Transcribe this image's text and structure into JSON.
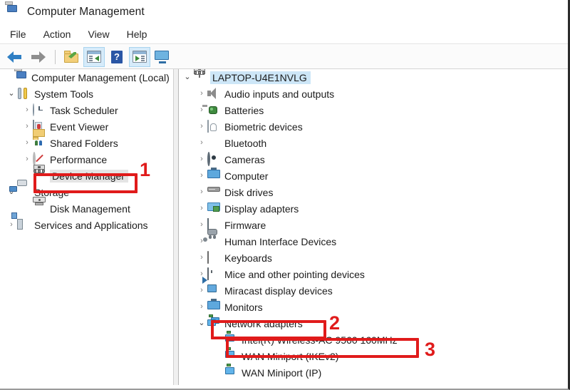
{
  "window": {
    "title": "Computer Management",
    "title_icon": "computer-management-icon"
  },
  "menu": {
    "items": [
      "File",
      "Action",
      "View",
      "Help"
    ]
  },
  "toolbar": {
    "buttons": [
      {
        "name": "back-button",
        "icon": "back-arrow-icon",
        "selected": false
      },
      {
        "name": "forward-button",
        "icon": "forward-arrow-icon",
        "selected": false
      },
      {
        "name": "up-one-level-button",
        "icon": "folder-up-icon",
        "selected": false
      },
      {
        "name": "show-hide-console-tree-button",
        "icon": "console-tree-icon",
        "selected": true
      },
      {
        "name": "help-button",
        "icon": "help-question-icon",
        "selected": false
      },
      {
        "name": "show-hide-action-pane-button",
        "icon": "action-pane-icon",
        "selected": true
      },
      {
        "name": "remote-connection-button",
        "icon": "monitor-icon",
        "selected": false
      }
    ]
  },
  "console_tree": {
    "root": {
      "label": "Computer Management (Local)",
      "icon": "computer-management-icon",
      "indent": 0,
      "chevron": "none"
    },
    "items": [
      {
        "label": "System Tools",
        "icon": "system-tools-icon",
        "indent": 1,
        "chevron": "open",
        "selected": false
      },
      {
        "label": "Task Scheduler",
        "icon": "clock-icon",
        "indent": 2,
        "chevron": "closed",
        "selected": false
      },
      {
        "label": "Event Viewer",
        "icon": "event-viewer-icon",
        "indent": 2,
        "chevron": "closed",
        "selected": false
      },
      {
        "label": "Shared Folders",
        "icon": "shared-folders-icon",
        "indent": 2,
        "chevron": "closed",
        "selected": false
      },
      {
        "label": "Performance",
        "icon": "performance-icon",
        "indent": 2,
        "chevron": "closed",
        "selected": false
      },
      {
        "label": "Device Manager",
        "icon": "device-manager-icon",
        "indent": 2,
        "chevron": "none",
        "selected": true
      },
      {
        "label": "Storage",
        "icon": "storage-icon",
        "indent": 1,
        "chevron": "open",
        "selected": false
      },
      {
        "label": "Disk Management",
        "icon": "disk-management-icon",
        "indent": 2,
        "chevron": "none",
        "selected": false
      },
      {
        "label": "Services and Applications",
        "icon": "services-icon",
        "indent": 1,
        "chevron": "closed",
        "selected": false
      }
    ]
  },
  "device_tree": {
    "root": {
      "label": "LAPTOP-U4E1NVLG",
      "icon": "device-manager-icon",
      "chevron": "open",
      "selected": true
    },
    "items": [
      {
        "label": "Audio inputs and outputs",
        "icon": "speaker-icon",
        "chevron": "closed",
        "indent": 1
      },
      {
        "label": "Batteries",
        "icon": "battery-icon",
        "chevron": "closed",
        "indent": 1
      },
      {
        "label": "Biometric devices",
        "icon": "fingerprint-icon",
        "chevron": "closed",
        "indent": 1
      },
      {
        "label": "Bluetooth",
        "icon": "bluetooth-icon",
        "chevron": "closed",
        "indent": 1
      },
      {
        "label": "Cameras",
        "icon": "camera-icon",
        "chevron": "closed",
        "indent": 1
      },
      {
        "label": "Computer",
        "icon": "monitor-icon",
        "chevron": "closed",
        "indent": 1
      },
      {
        "label": "Disk drives",
        "icon": "hard-disk-icon",
        "chevron": "closed",
        "indent": 1
      },
      {
        "label": "Display adapters",
        "icon": "display-adapter-icon",
        "chevron": "closed",
        "indent": 1
      },
      {
        "label": "Firmware",
        "icon": "firmware-icon",
        "chevron": "closed",
        "indent": 1
      },
      {
        "label": "Human Interface Devices",
        "icon": "hid-icon",
        "chevron": "closed",
        "indent": 1
      },
      {
        "label": "Keyboards",
        "icon": "keyboard-icon",
        "chevron": "closed",
        "indent": 1
      },
      {
        "label": "Mice and other pointing devices",
        "icon": "mouse-icon",
        "chevron": "closed",
        "indent": 1
      },
      {
        "label": "Miracast display devices",
        "icon": "miracast-icon",
        "chevron": "closed",
        "indent": 1
      },
      {
        "label": "Monitors",
        "icon": "monitor-icon",
        "chevron": "closed",
        "indent": 1
      },
      {
        "label": "Network adapters",
        "icon": "network-adapter-icon",
        "chevron": "open",
        "indent": 1
      },
      {
        "label": "Intel(R) Wireless-AC 9560 160MHz",
        "icon": "network-adapter-icon",
        "chevron": "none",
        "indent": 2
      },
      {
        "label": "WAN Miniport (IKEv2)",
        "icon": "network-adapter-icon",
        "chevron": "none",
        "indent": 2
      },
      {
        "label": "WAN Miniport (IP)",
        "icon": "network-adapter-icon",
        "chevron": "none",
        "indent": 2
      }
    ]
  },
  "annotations": {
    "color": "#e01b1b",
    "steps": [
      {
        "number": "1",
        "target": "Device Manager"
      },
      {
        "number": "2",
        "target": "Network adapters"
      },
      {
        "number": "3",
        "target": "Intel(R) Wireless-AC 9560 160MHz"
      }
    ]
  }
}
